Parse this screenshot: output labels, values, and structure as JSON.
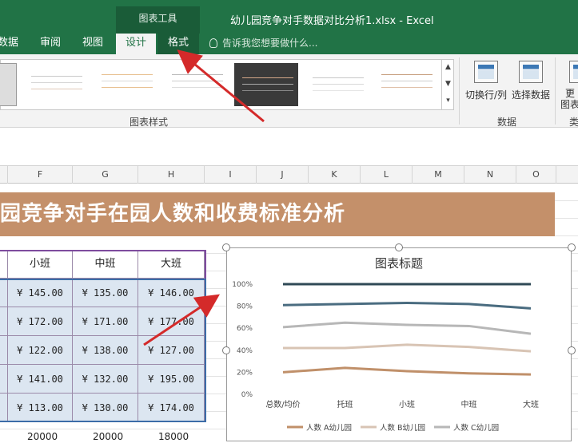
{
  "titlebar": {
    "tools_header": "图表工具",
    "doc_title": "幼儿园竞争对手数据对比分析1.xlsx - Excel"
  },
  "tabs": {
    "data": "数据",
    "review": "审阅",
    "view": "视图",
    "design": "设计",
    "format": "格式",
    "tellme": "告诉我您想要做什么..."
  },
  "ribbon": {
    "chart_styles_label": "图表样式",
    "switch_row_col": "切换行/列",
    "select_data": "选择数据",
    "data_group_label": "数据",
    "change_partial": "更",
    "change_partial2": "图表",
    "type_partial": "类"
  },
  "columns": [
    "F",
    "G",
    "H",
    "I",
    "J",
    "K",
    "L",
    "M",
    "N",
    "O"
  ],
  "banner": "园竞争对手在园人数和收费标准分析",
  "table": {
    "headers": [
      "小班",
      "中班",
      "大班"
    ],
    "rows": [
      [
        "¥  145.00",
        "¥  135.00",
        "¥  146.00"
      ],
      [
        "¥  172.00",
        "¥  171.00",
        "¥  177.00"
      ],
      [
        "¥  122.00",
        "¥  138.00",
        "¥  127.00"
      ],
      [
        "¥  141.00",
        "¥  132.00",
        "¥  195.00"
      ],
      [
        "¥  113.00",
        "¥  130.00",
        "¥  174.00"
      ]
    ],
    "below": [
      "20000",
      "20000",
      "18000"
    ]
  },
  "chart_data": {
    "type": "line",
    "title": "图表标题",
    "categories": [
      "总数/均价",
      "托班",
      "小班",
      "中班",
      "大班"
    ],
    "ylim": [
      0,
      100
    ],
    "y_ticks": [
      "0%",
      "20%",
      "40%",
      "60%",
      "80%",
      "100%"
    ],
    "grid": false,
    "legend_placement": "bottom",
    "series": [
      {
        "name": "人数 A幼儿园",
        "color": "#c0906a",
        "values": [
          20,
          24,
          21,
          19,
          18
        ]
      },
      {
        "name": "人数 B幼儿园",
        "color": "#d8c4b4",
        "values": [
          42,
          42,
          45,
          43,
          39
        ]
      },
      {
        "name": "人数 C幼儿园",
        "color": "#b7b7b7",
        "values": [
          61,
          65,
          63,
          62,
          55
        ]
      },
      {
        "name": "",
        "color": "#4a6c80",
        "values": [
          81,
          82,
          83,
          82,
          78
        ]
      },
      {
        "name": "",
        "color": "#2f4956",
        "values": [
          100,
          100,
          100,
          100,
          100
        ]
      }
    ]
  }
}
